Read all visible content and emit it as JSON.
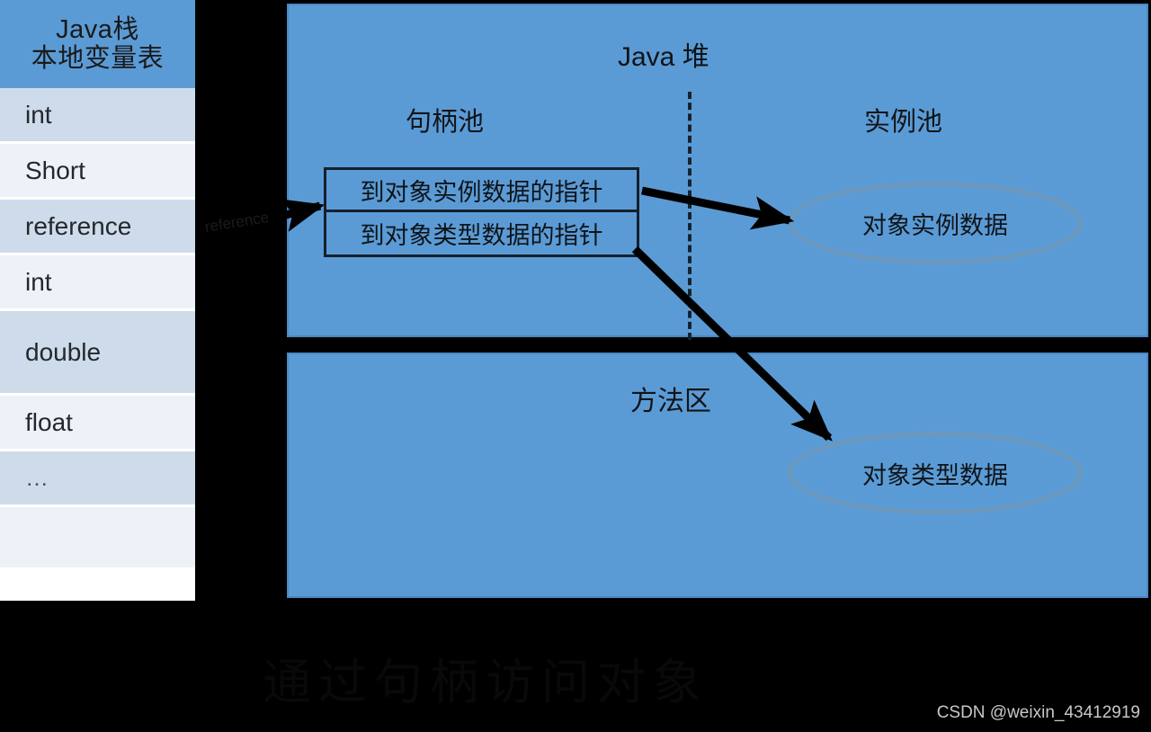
{
  "stack_table": {
    "header_line1": "Java栈",
    "header_line2": "本地变量表",
    "rows": [
      {
        "label": "int"
      },
      {
        "label": "Short"
      },
      {
        "label": "reference"
      },
      {
        "label": "int"
      },
      {
        "label": "double"
      },
      {
        "label": "float"
      },
      {
        "label": "…"
      },
      {
        "label": ""
      }
    ]
  },
  "heap": {
    "title": "Java 堆",
    "handle_pool_label": "句柄池",
    "instance_pool_label": "实例池",
    "pointer_to_instance_data": "到对象实例数据的指针",
    "pointer_to_type_data": "到对象类型数据的指针",
    "instance_data_ellipse": "对象实例数据"
  },
  "method_area": {
    "title": "方法区",
    "type_data_ellipse": "对象类型数据"
  },
  "watermarks": {
    "caption": "通过句柄访问对象",
    "csdn": "CSDN @weixin_43412919",
    "reference_arrow_label": "reference"
  },
  "colors": {
    "panel_blue": "#5b9bd5",
    "row_shade_a": "#cedbea",
    "row_shade_b": "#eef2f8",
    "ellipse_border": "#6d97bb",
    "outline_black": "#14202c",
    "background": "#000000"
  }
}
